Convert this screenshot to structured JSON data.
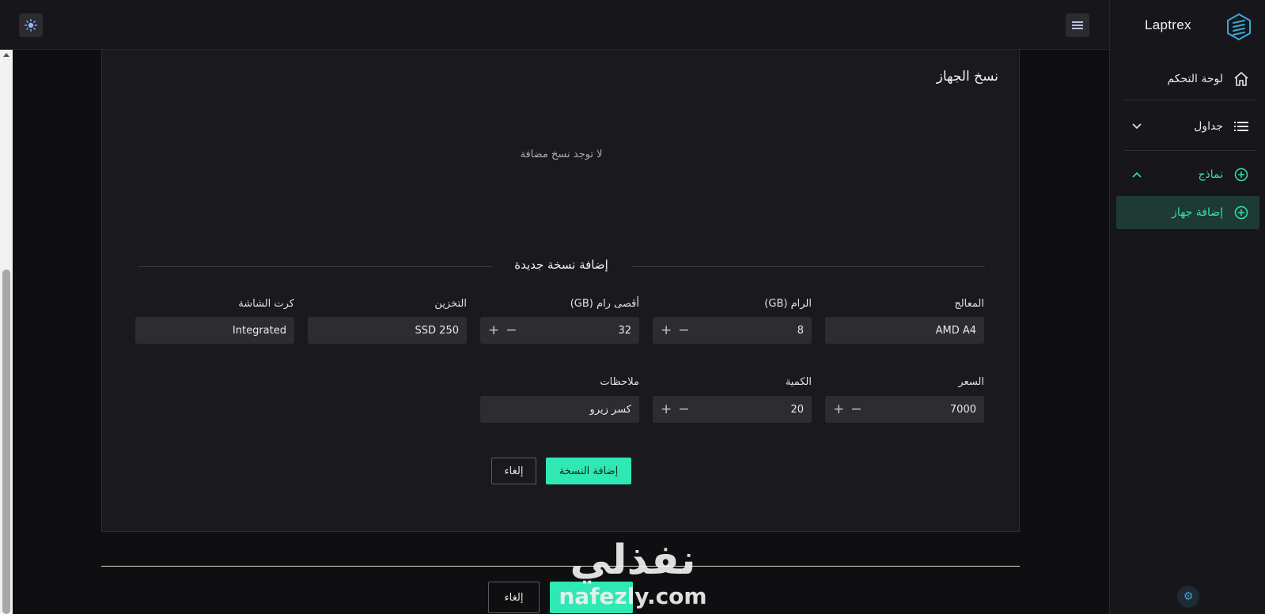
{
  "brand": {
    "name": "Laptrex"
  },
  "sidebar": {
    "items": [
      {
        "label": "لوحة التحكم",
        "icon": "home-icon"
      },
      {
        "label": "جداول",
        "icon": "list-icon"
      },
      {
        "label": "نماذج",
        "icon": "plus-circle-icon"
      },
      {
        "label": "إضافة جهاز",
        "icon": "plus-circle-icon"
      }
    ]
  },
  "card": {
    "title": "نسخ الجهاز",
    "empty_message": "لا توجد نسخ مضافة",
    "section_title": "إضافة نسخة جديدة"
  },
  "form": {
    "processor": {
      "label": "المعالج",
      "value": "AMD A4"
    },
    "ram": {
      "label": "الرام (GB)",
      "value": "8"
    },
    "max_ram": {
      "label": "أقصى رام (GB)",
      "value": "32"
    },
    "storage": {
      "label": "التخزين",
      "value": "SSD 250"
    },
    "gpu": {
      "label": "كرت الشاشة",
      "value": "Integrated"
    },
    "price": {
      "label": "السعر",
      "value": "7000"
    },
    "quantity": {
      "label": "الكمية",
      "value": "20"
    },
    "notes": {
      "label": "ملاحظات",
      "value": "كسر زيرو"
    },
    "add_copy_label": "إضافة النسخة",
    "cancel_label": "إلغاء"
  },
  "footer": {
    "cancel_label": "إلغاء"
  },
  "watermark": {
    "arabic": "نفذلي",
    "latin": "nafezly.com"
  },
  "colors": {
    "accent": "#2fe8b3",
    "background": "#0f0f12",
    "panel": "#1a1a1e"
  }
}
